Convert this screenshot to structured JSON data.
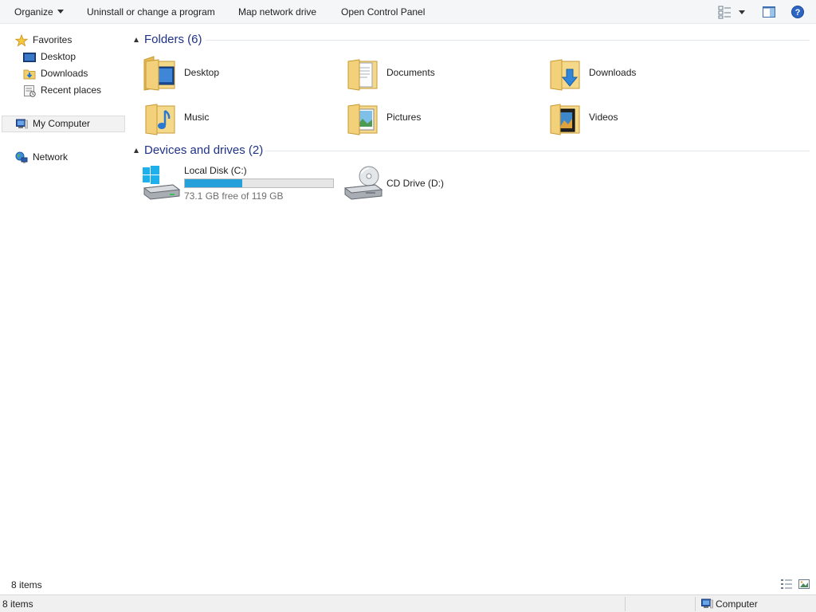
{
  "toolbar": {
    "organize": "Organize",
    "uninstall": "Uninstall or change a program",
    "map_drive": "Map network drive",
    "control_panel": "Open Control Panel",
    "icons": [
      "change-view-icon",
      "preview-pane-icon",
      "help-icon"
    ]
  },
  "nav": {
    "favorites": {
      "label": "Favorites",
      "icon": "star-icon"
    },
    "favorite_items": [
      {
        "label": "Desktop",
        "icon": "desktop-icon"
      },
      {
        "label": "Downloads",
        "icon": "downloads-folder-icon"
      },
      {
        "label": "Recent places",
        "icon": "recent-places-icon"
      }
    ],
    "computer": {
      "label": "My Computer",
      "icon": "computer-icon"
    },
    "network": {
      "label": "Network",
      "icon": "network-icon"
    }
  },
  "folders": {
    "heading": "Folders (6)",
    "items": [
      {
        "label": "Desktop",
        "icon": "desktop-folder-icon"
      },
      {
        "label": "Documents",
        "icon": "documents-folder-icon"
      },
      {
        "label": "Downloads",
        "icon": "downloads-folder-icon"
      },
      {
        "label": "Music",
        "icon": "music-folder-icon"
      },
      {
        "label": "Pictures",
        "icon": "pictures-folder-icon"
      },
      {
        "label": "Videos",
        "icon": "videos-folder-icon"
      }
    ]
  },
  "drives": {
    "heading": "Devices and drives (2)",
    "items": [
      {
        "label": "Local Disk (C:)",
        "free_text": "73.1 GB free of 119 GB",
        "used_fraction": 0.386,
        "icon": "hard-drive-icon"
      },
      {
        "label": "CD Drive (D:)",
        "icon": "cd-drive-icon"
      }
    ]
  },
  "details": {
    "count": "8 items"
  },
  "status": {
    "count": "8 items",
    "zone": "Computer"
  },
  "colors": {
    "accent": "#1e3287",
    "bar_fill": "#26a0da",
    "folder": "#f3d37a"
  }
}
